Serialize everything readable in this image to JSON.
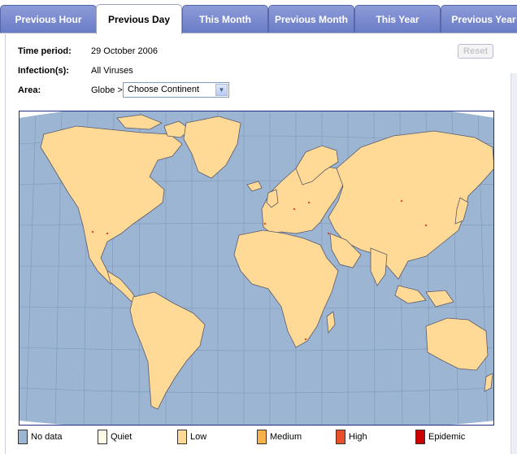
{
  "tabs": [
    {
      "label": "Previous Hour",
      "active": false
    },
    {
      "label": "Previous Day",
      "active": true
    },
    {
      "label": "This Month",
      "active": false
    },
    {
      "label": "Previous Month",
      "active": false
    },
    {
      "label": "This Year",
      "active": false
    },
    {
      "label": "Previous Year",
      "active": false
    }
  ],
  "info": {
    "time_period_label": "Time period:",
    "time_period_value": "29 October 2006",
    "infections_label": "Infection(s):",
    "infections_value": "All Viruses",
    "area_label": "Area:",
    "area_prefix": "Globe >",
    "area_select": "Choose Continent"
  },
  "reset_label": "Reset",
  "legend": [
    {
      "label": "No data",
      "color": "#9bb5d3"
    },
    {
      "label": "Quiet",
      "color": "#fffbe6"
    },
    {
      "label": "Low",
      "color": "#ffd996"
    },
    {
      "label": "Medium",
      "color": "#f7b347"
    },
    {
      "label": "High",
      "color": "#e8502a"
    },
    {
      "label": "Epidemic",
      "color": "#cc0000"
    }
  ],
  "colors": {
    "tab_bg": "#7888cf",
    "ocean": "#9bb5d3",
    "land": "#ffd996",
    "map_border": "#1f2f86"
  }
}
